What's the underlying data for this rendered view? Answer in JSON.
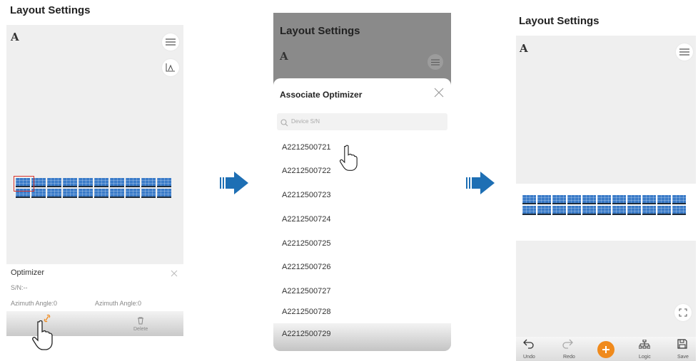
{
  "left": {
    "title": "Layout Settings",
    "sheet": {
      "title": "Optimizer",
      "sn": "S/N:--",
      "azimuth_left": "Azimuth Angle:0",
      "azimuth_right": "Azimuth Angle:0",
      "delete_label": "Delete"
    }
  },
  "middle": {
    "header_title": "Layout Settings",
    "dialog_title": "Associate Optimizer",
    "search_placeholder": "Device S/N",
    "devices": [
      "A2212500721",
      "A2212500722",
      "A2212500723",
      "A2212500724",
      "A2212500725",
      "A2212500726",
      "A2212500727",
      "A2212500728",
      "A2212500729"
    ]
  },
  "right": {
    "title": "Layout Settings",
    "toolbar": {
      "undo": "Undo",
      "redo": "Redo",
      "logic": "Logic",
      "save": "Save"
    }
  },
  "colors": {
    "panel_blue": "#3a7bc8",
    "flow_arrow": "#1e6fb4",
    "add_orange": "#f08a1c",
    "selection_red": "#d9342b"
  }
}
